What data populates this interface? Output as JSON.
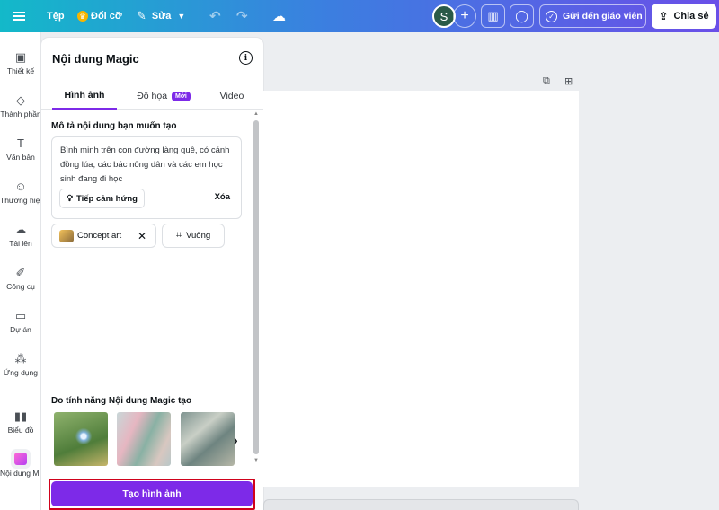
{
  "topbar": {
    "file_label": "Tệp",
    "resize_label": "Đổi cỡ",
    "edit_label": "Sửa",
    "avatar_initial": "S",
    "send_label": "Gửi đến giáo viên",
    "share_label": "Chia sẻ"
  },
  "sidebar": {
    "items": [
      {
        "label": "Thiết kế",
        "icon": "layout-icon"
      },
      {
        "label": "Thành phần",
        "icon": "elements-icon"
      },
      {
        "label": "Văn bản",
        "icon": "text-icon"
      },
      {
        "label": "Thương hiệu",
        "icon": "brand-icon"
      },
      {
        "label": "Tải lên",
        "icon": "upload-icon"
      },
      {
        "label": "Công cụ",
        "icon": "draw-icon"
      },
      {
        "label": "Dự án",
        "icon": "folder-icon"
      },
      {
        "label": "Ứng dụng",
        "icon": "apps-icon"
      },
      {
        "label": "Biểu đồ",
        "icon": "chart-icon"
      },
      {
        "label": "Nội dung M...",
        "icon": "magic-media-icon"
      }
    ]
  },
  "panel": {
    "title": "Nội dung Magic",
    "tabs": [
      {
        "label": "Hình ảnh",
        "active": true
      },
      {
        "label": "Đồ họa",
        "badge": "Mới"
      },
      {
        "label": "Video"
      }
    ],
    "prompt_label": "Mô tả nội dung bạn muốn tạo",
    "prompt_text": "Bình minh trên con đường làng quê, có cánh đồng lúa, các bác nông dân và các em học sinh đang đi học",
    "inspire_label": "Tiếp cảm hứng",
    "clear_label": "Xóa",
    "style_chip": "Concept art",
    "ratio_chip": "Vuông",
    "gallery_label": "Do tính năng Nội dung Magic tạo",
    "generate_label": "Tạo hình ảnh"
  },
  "colors": {
    "accent": "#7d2ae8",
    "highlight": "#d0021b"
  }
}
